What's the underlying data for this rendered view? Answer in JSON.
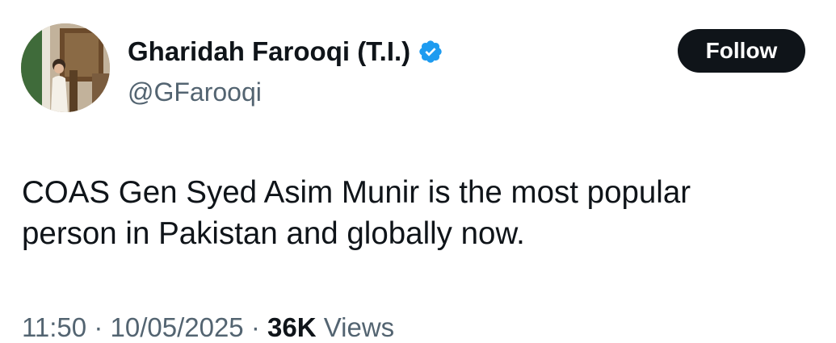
{
  "author": {
    "display_name": "Gharidah Farooqi (T.I.)",
    "handle": "@GFarooqi",
    "verified_icon": "verified-badge-icon",
    "verified_color": "#1d9bf0",
    "avatar_icon": "profile-photo"
  },
  "follow_button": {
    "label": "Follow"
  },
  "tweet": {
    "text": "COAS Gen Syed Asim Munir is the most popular\nperson in Pakistan and globally now."
  },
  "meta": {
    "time": "11:50",
    "separator": "·",
    "date": "10/05/2025",
    "views_count": "36K",
    "views_label": "Views"
  },
  "colors": {
    "text_primary": "#0f1419",
    "text_secondary": "#536471",
    "button_bg": "#0f1419",
    "button_text": "#ffffff"
  }
}
